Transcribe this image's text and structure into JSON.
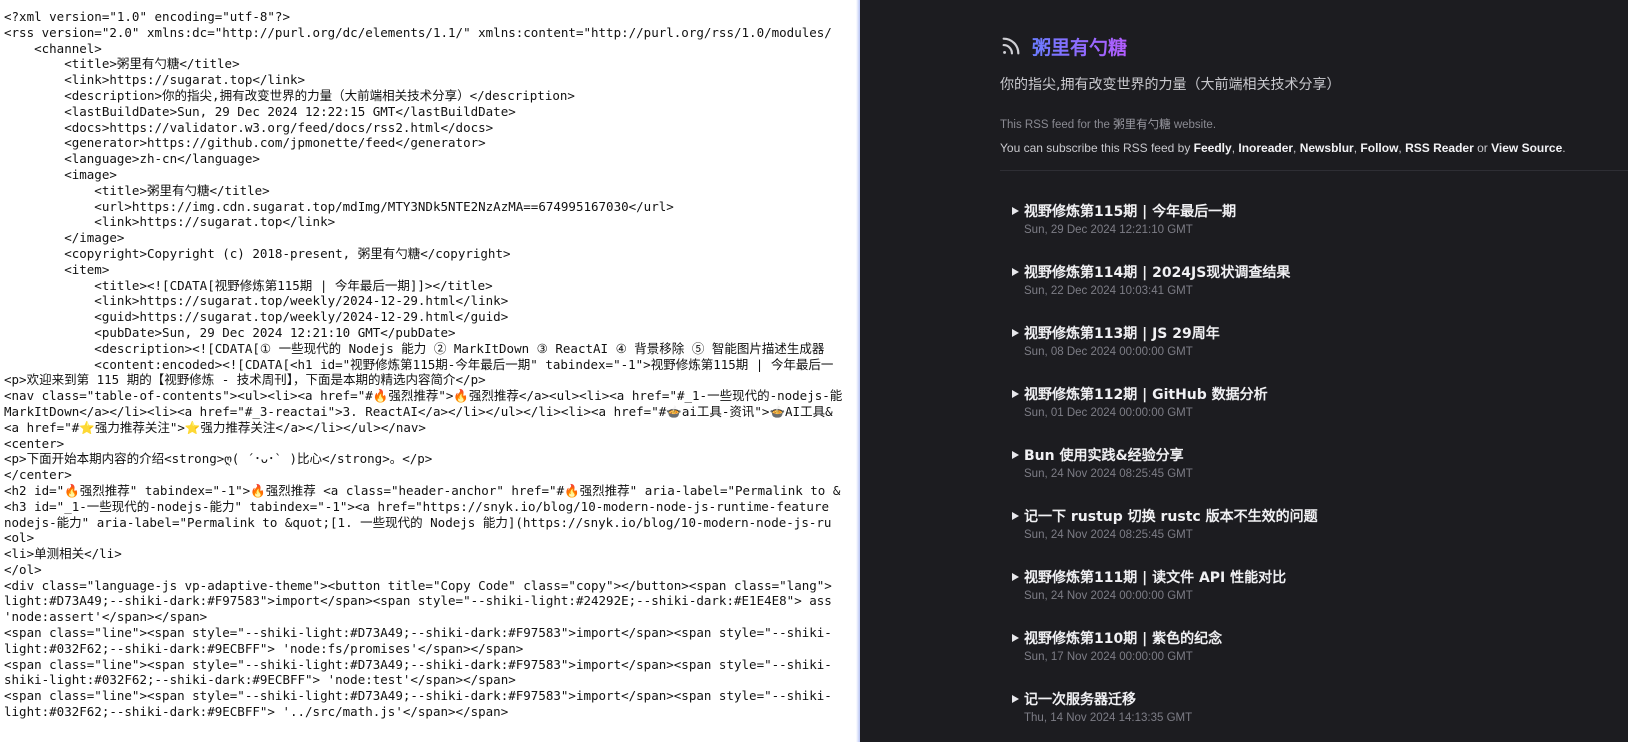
{
  "source": {
    "lines": [
      "<?xml version=\"1.0\" encoding=\"utf-8\"?>",
      "<rss version=\"2.0\" xmlns:dc=\"http://purl.org/dc/elements/1.1/\" xmlns:content=\"http://purl.org/rss/1.0/modules/",
      "    <channel>",
      "        <title>粥里有勺糖</title>",
      "        <link>https://sugarat.top</link>",
      "        <description>你的指尖,拥有改变世界的力量（大前端相关技术分享）</description>",
      "        <lastBuildDate>Sun, 29 Dec 2024 12:22:15 GMT</lastBuildDate>",
      "        <docs>https://validator.w3.org/feed/docs/rss2.html</docs>",
      "        <generator>https://github.com/jpmonette/feed</generator>",
      "        <language>zh-cn</language>",
      "        <image>",
      "            <title>粥里有勺糖</title>",
      "            <url>https://img.cdn.sugarat.top/mdImg/MTY3NDk5NTE2NzAzMA==674995167030</url>",
      "            <link>https://sugarat.top</link>",
      "        </image>",
      "        <copyright>Copyright (c) 2018-present, 粥里有勺糖</copyright>",
      "        <item>",
      "            <title><![CDATA[视野修炼第115期 | 今年最后一期]]></title>",
      "            <link>https://sugarat.top/weekly/2024-12-29.html</link>",
      "            <guid>https://sugarat.top/weekly/2024-12-29.html</guid>",
      "            <pubDate>Sun, 29 Dec 2024 12:21:10 GMT</pubDate>",
      "            <description><![CDATA[① 一些现代的 Nodejs 能力 ② MarkItDown ③ ReactAI ④ 背景移除 ⑤ 智能图片描述生成器",
      "            <content:encoded><![CDATA[<h1 id=\"视野修炼第115期-今年最后一期\" tabindex=\"-1\">视野修炼第115期 | 今年最后一",
      "<p>欢迎来到第 115 期的【视野修炼 - 技术周刊】，下面是本期的精选内容简介</p>",
      "<nav class=\"table-of-contents\"><ul><li><a href=\"#🔥强烈推荐\">🔥强烈推荐</a><ul><li><a href=\"#_1-一些现代的-nodejs-能",
      "MarkItDown</a></li><li><a href=\"#_3-reactai\">3. ReactAI</a></li></ul></li><li><a href=\"#🍲ai工具-资讯\">🍲AI工具&",
      "<a href=\"#⭐强力推荐关注\">⭐强力推荐关注</a></li></ul></nav>",
      "<center>",
      "<p>下面开始本期内容的介绍<strong>ღ( ´･ᴗ･` )比心</strong>。</p>",
      "</center>",
      "<h2 id=\"🔥强烈推荐\" tabindex=\"-1\">🔥强烈推荐 <a class=\"header-anchor\" href=\"#🔥强烈推荐\" aria-label=\"Permalink to &",
      "<h3 id=\"_1-一些现代的-nodejs-能力\" tabindex=\"-1\"><a href=\"https://snyk.io/blog/10-modern-node-js-runtime-feature",
      "nodejs-能力\" aria-label=\"Permalink to &quot;[1. 一些现代的 Nodejs 能力](https://snyk.io/blog/10-modern-node-js-ru",
      "<ol>",
      "<li>单测相关</li>",
      "</ol>",
      "<div class=\"language-js vp-adaptive-theme\"><button title=\"Copy Code\" class=\"copy\"></button><span class=\"lang\">",
      "light:#D73A49;--shiki-dark:#F97583\">import</span><span style=\"--shiki-light:#24292E;--shiki-dark:#E1E4E8\"> ass",
      "'node:assert'</span></span>",
      "<span class=\"line\"><span style=\"--shiki-light:#D73A49;--shiki-dark:#F97583\">import</span><span style=\"--shiki-",
      "light:#032F62;--shiki-dark:#9ECBFF\"> 'node:fs/promises'</span></span>",
      "<span class=\"line\"><span style=\"--shiki-light:#D73A49;--shiki-dark:#F97583\">import</span><span style=\"--shiki-",
      "shiki-light:#032F62;--shiki-dark:#9ECBFF\"> 'node:test'</span></span>",
      "<span class=\"line\"><span style=\"--shiki-light:#D73A49;--shiki-dark:#F97583\">import</span><span style=\"--shiki-",
      "light:#032F62;--shiki-dark:#9ECBFF\"> '../src/math.js'</span></span>"
    ]
  },
  "preview": {
    "feed_title": "粥里有勺糖",
    "feed_description": "你的指尖,拥有改变世界的力量（大前端相关技术分享）",
    "note_prefix": "This RSS feed for the ",
    "note_site": "粥里有勺糖",
    "note_suffix": " website.",
    "subscribe_prefix": "You can subscribe this RSS feed by ",
    "subscribe_links": [
      "Feedly",
      "Inoreader",
      "Newsblur",
      "Follow",
      "RSS Reader"
    ],
    "subscribe_or": " or ",
    "view_source": "View Source",
    "items": [
      {
        "title": "视野修炼第115期 | 今年最后一期",
        "date": "Sun, 29 Dec 2024 12:21:10 GMT"
      },
      {
        "title": "视野修炼第114期 | 2024JS现状调查结果",
        "date": "Sun, 22 Dec 2024 10:03:41 GMT"
      },
      {
        "title": "视野修炼第113期 | JS 29周年",
        "date": "Sun, 08 Dec 2024 00:00:00 GMT"
      },
      {
        "title": "视野修炼第112期 | GitHub 数据分析",
        "date": "Sun, 01 Dec 2024 00:00:00 GMT"
      },
      {
        "title": "Bun 使用实践&经验分享",
        "date": "Sun, 24 Nov 2024 08:25:45 GMT"
      },
      {
        "title": "记一下 rustup 切换 rustc 版本不生效的问题",
        "date": "Sun, 24 Nov 2024 08:25:45 GMT"
      },
      {
        "title": "视野修炼第111期 | 读文件 API 性能对比",
        "date": "Sun, 24 Nov 2024 00:00:00 GMT"
      },
      {
        "title": "视野修炼第110期 | 紫色的纪念",
        "date": "Sun, 17 Nov 2024 00:00:00 GMT"
      },
      {
        "title": "记一次服务器迁移",
        "date": "Thu, 14 Nov 2024 14:13:35 GMT"
      }
    ],
    "colors": {
      "background": "#1c1c20",
      "title_gradient_start": "#6a7cff",
      "title_gradient_end": "#b35cff",
      "rss_icon": "#cfcfd4"
    },
    "icons": {
      "feed": "rss-icon",
      "expand": "triangle-right-icon"
    }
  }
}
